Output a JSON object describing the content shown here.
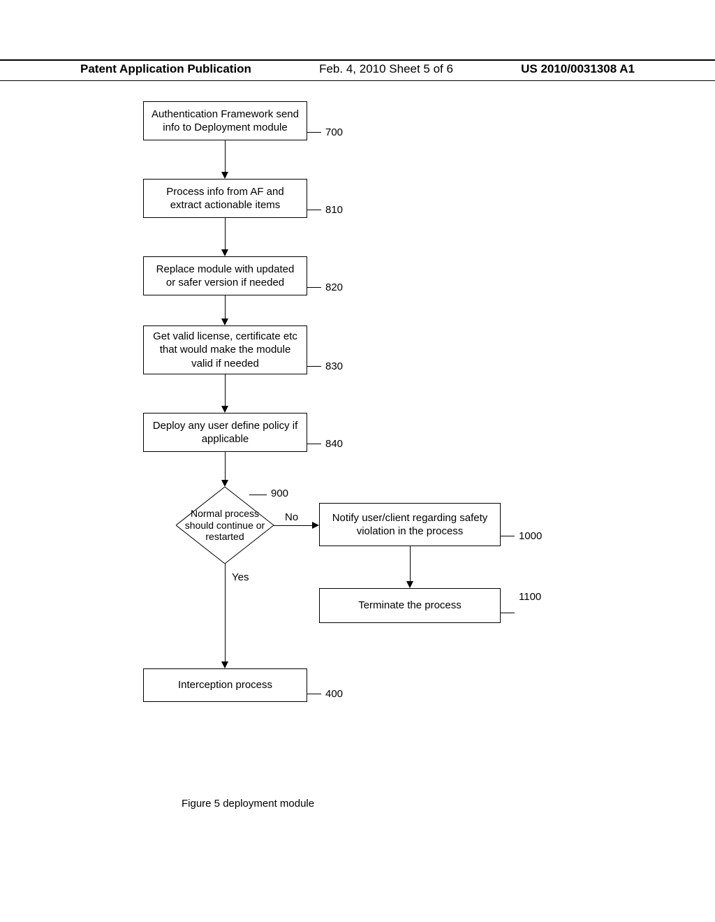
{
  "header": {
    "left": "Patent Application Publication",
    "center": "Feb. 4, 2010  Sheet 5 of 6",
    "right": "US 2010/0031308 A1"
  },
  "boxes": {
    "b700": "Authentication Framework send info to Deployment module",
    "b810": "Process info from AF and extract actionable items",
    "b820": "Replace module with updated or safer  version if needed",
    "b830": "Get valid license, certificate etc that would make the module valid if needed",
    "b840": "Deploy any user define policy if applicable",
    "b900": "Normal process should continue or restarted",
    "b1000": "Notify user/client regarding safety violation in the process",
    "b1100": "Terminate the process",
    "b400": "Interception process"
  },
  "refs": {
    "r700": "700",
    "r810": "810",
    "r820": "820",
    "r830": "830",
    "r840": "840",
    "r900": "900",
    "r1000": "1000",
    "r1100": "1100",
    "r400": "400"
  },
  "labels": {
    "no": "No",
    "yes": "Yes"
  },
  "caption": "Figure 5 deployment module"
}
